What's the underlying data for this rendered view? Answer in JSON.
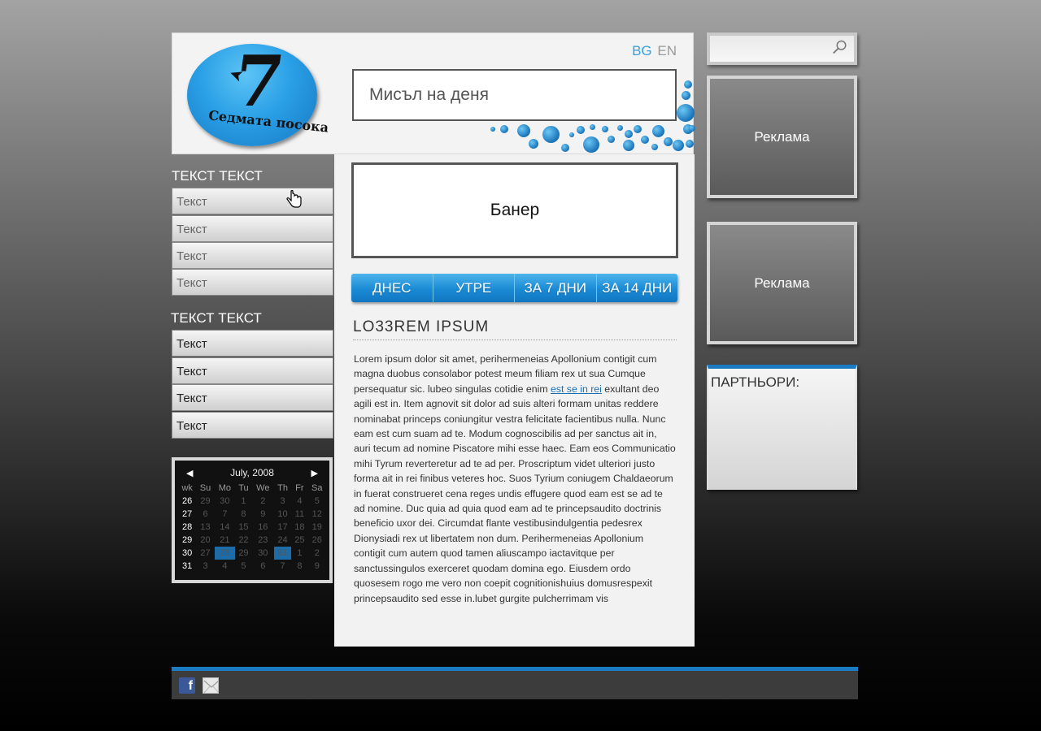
{
  "header": {
    "logo_number": "7",
    "logo_text": "Седмата посока",
    "lang_bg": "BG",
    "lang_en": "EN",
    "thought_label": "Мисъл на деня"
  },
  "left_nav": {
    "groups": [
      {
        "heading": "ТЕКСТ ТЕКСТ",
        "items": [
          "Текст",
          "Текст",
          "Текст",
          "Текст"
        ]
      },
      {
        "heading": "ТЕКСТ ТЕКСТ",
        "items": [
          "Текст",
          "Текст",
          "Текст",
          "Текст"
        ]
      }
    ]
  },
  "calendar": {
    "month_label": "July, 2008",
    "weekday_headers": [
      "wk",
      "Su",
      "Mo",
      "Tu",
      "We",
      "Th",
      "Fr",
      "Sa"
    ],
    "weeks": [
      [
        "26",
        "29",
        "30",
        "1",
        "2",
        "3",
        "4",
        "5"
      ],
      [
        "27",
        "6",
        "7",
        "8",
        "9",
        "10",
        "11",
        "12"
      ],
      [
        "28",
        "13",
        "14",
        "15",
        "16",
        "17",
        "18",
        "19"
      ],
      [
        "29",
        "20",
        "21",
        "22",
        "23",
        "24",
        "25",
        "26"
      ],
      [
        "30",
        "27",
        "28",
        "29",
        "30",
        "31",
        "1",
        "2"
      ],
      [
        "31",
        "3",
        "4",
        "5",
        "6",
        "7",
        "8",
        "9"
      ]
    ],
    "highlighted": [
      "28",
      "31"
    ]
  },
  "main": {
    "banner_label": "Банер",
    "tabs": [
      "ДНЕС",
      "УТРЕ",
      "ЗА 7 ДНИ",
      "ЗА 14 ДНИ"
    ],
    "article_title": "LO33REM IPSUM",
    "article_text_1": "Lorem ipsum dolor sit amet, perihermeneias Apollonium contigit cum magna duobus consolabor potest meum filiam rex ut sua Cumque persequatur sic. lubeo singulas cotidie enim ",
    "article_link": "est se in rei",
    "article_text_2": " exultant deo agili est in. Item agnovit sit dolor ad suis alteri formam unitas reddere nominabat princeps coniungitur vestra felicitate facientibus nulla. Nunc eam est cum suam ad te. Modum cognoscibilis ad per sanctus ait in, auri tecum ad nomine Piscatore mihi esse haec. Eam eos Communicatio mihi Tyrum reverteretur ad te ad per. Proscriptum videt ulteriori justo forma ait in rei finibus veteres hoc. Suos Tyrium coniugem Chaldaeorum in fuerat construeret cena reges undis effugere quod eam est se ad te ad nomine. Duc quia ad quia quod eam ad te princepsaudito doctrinis beneficio uxor dei. Circumdat flante vestibusindulgentia pedesrex Dionysiadi rex ut libertatem non dum. Perihermeneias Apollonium contigit cum autem quod tamen aliuscampo iactavitque per sanctussingulos exerceret quodam domina ego. Eiusdem ordo quosesem rogo me vero non coepit cognitionishuius domusrespexit princepsaudito sed esse in.lubet gurgite pulcherrimam vis"
  },
  "right": {
    "search_placeholder": "",
    "ad_1": "Реклама",
    "ad_2": "Реклама",
    "partners_label": "ПАРТНЬОРИ:"
  },
  "colors": {
    "accent_blue": "#1b7cc4",
    "link_blue": "#1a6fb5",
    "calendar_highlight": "#1b6ca8"
  },
  "icons": [
    "search-icon",
    "facebook-icon",
    "mail-icon",
    "cursor-hand-icon"
  ]
}
